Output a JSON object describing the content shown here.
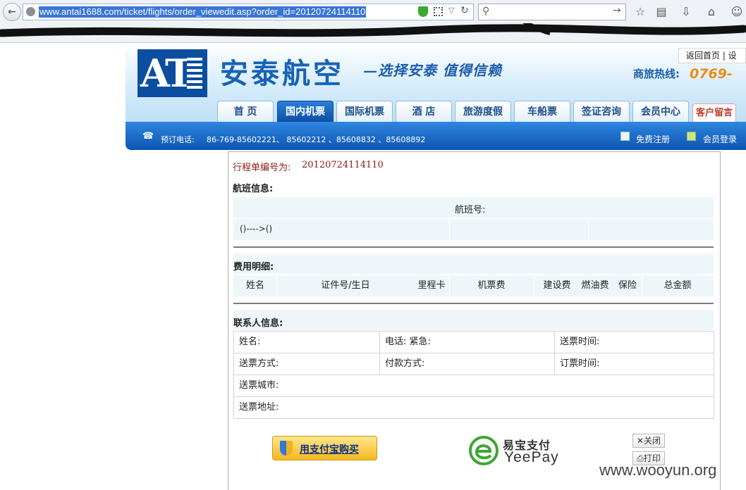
{
  "browser": {
    "url": "www.antai1688.com/ticket/flights/order_viewedit.asp?order_id=20120724114110",
    "icons": [
      "back-icon",
      "globe-icon",
      "shield-icon",
      "qr-icon",
      "dropdown-icon",
      "reload-icon",
      "search-icon",
      "go-arrow-icon",
      "star-icon",
      "reading-list-icon",
      "download-icon",
      "home-icon",
      "smiley-icon"
    ]
  },
  "site": {
    "logo_text": "AT",
    "brand": "安泰航空",
    "slogan": "—选择安泰 值得信赖",
    "hotline_label": "商旅热线:",
    "hotline_number": "0769-",
    "top_links": "返回首页 | 设",
    "tabs": [
      "首 页",
      "国内机票",
      "国际机票",
      "酒 店",
      "旅游度假",
      "车船票",
      "签证咨询",
      "会员中心",
      "客户留言"
    ],
    "active_tab": "国内机票",
    "booking_phone_label": "预订电话:",
    "booking_phones": "86-769-85602221、 85602212 、85608832 、85608892",
    "register": "免费注册",
    "login": "会员登录"
  },
  "order": {
    "itinerary_label": "行程单编号为:",
    "itinerary_no": "20120724114110",
    "flight_section": "航班信息:",
    "flight_no_label": "航班号:",
    "route": "()---->()",
    "fee_section": "费用明细:",
    "fee_columns": [
      "姓名",
      "证件号/生日",
      "里程卡",
      "机票费",
      "建设费",
      "燃油费",
      "保险",
      "总金额"
    ],
    "contact_section": "联系人信息:",
    "contact_fields": {
      "name": "姓名:",
      "phone": "电话: 紧急:",
      "delivery_time": "送票时间:",
      "delivery_method": "送票方式:",
      "payment_method": "付款方式:",
      "order_time": "订票时间:",
      "delivery_city": "送票城市:",
      "delivery_address": "送票地址:"
    }
  },
  "payment": {
    "alipay_label": "用支付宝购买",
    "yeepay_cn": "易宝支付",
    "yeepay_en": "YeePay",
    "close_label": "关闭",
    "print_label": "打印"
  },
  "watermark": "www.wooyun.org",
  "colors": {
    "brand_blue": "#1663b8",
    "bar_blue": "#0c55b0",
    "itinerary_red": "#8b1a1a",
    "hotline_orange": "#f08a1a",
    "yeepay_green": "#3fa535"
  }
}
